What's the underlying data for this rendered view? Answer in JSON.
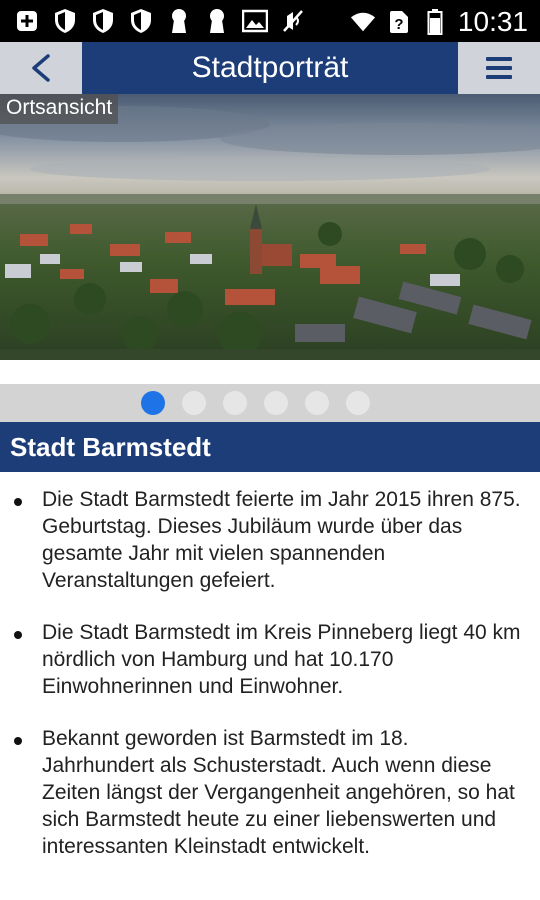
{
  "statusbar": {
    "time": "10:31",
    "icons": [
      "plus-box-icon",
      "shield-icon",
      "shield-icon",
      "shield-icon",
      "keyhole-icon",
      "keyhole-icon",
      "image-icon",
      "mute-icon",
      "wifi-icon",
      "no-sim-icon",
      "battery-icon"
    ]
  },
  "appbar": {
    "title": "Stadtporträt",
    "back_glyph": "<",
    "menu_glyph": "≡"
  },
  "hero": {
    "label": "Ortsansicht"
  },
  "pager": {
    "count": 6,
    "active_index": 0
  },
  "section": {
    "title": "Stadt Barmstedt"
  },
  "paragraphs": [
    "Die Stadt Barmstedt feierte im Jahr 2015 ihren 875. Geburtstag. Dieses Jubiläum wurde über das gesamte Jahr mit vielen spannenden Veranstaltungen gefeiert.",
    "Die Stadt Barmstedt im Kreis Pinneberg liegt 40 km nördlich von Hamburg und hat 10.170 Einwohnerinnen und Einwohner.",
    "Bekannt geworden ist Barmstedt im 18. Jahrhundert als Schusterstadt. Auch wenn diese Zeiten längst der Vergangenheit angehören, so hat sich Barmstedt heute zu einer liebenswerten und interessanten Kleinstadt entwickelt."
  ],
  "colors": {
    "primary": "#1d3d78",
    "nav_button_bg": "#d0d4da",
    "active_dot": "#1e74e6",
    "inactive_dot": "#e6e6e6"
  }
}
